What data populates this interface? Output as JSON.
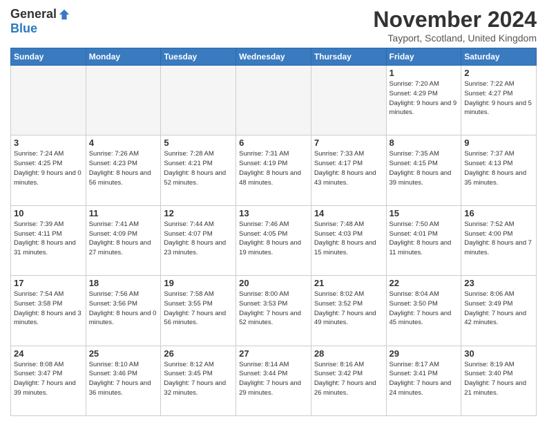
{
  "header": {
    "logo_general": "General",
    "logo_blue": "Blue",
    "month_title": "November 2024",
    "location": "Tayport, Scotland, United Kingdom"
  },
  "days_of_week": [
    "Sunday",
    "Monday",
    "Tuesday",
    "Wednesday",
    "Thursday",
    "Friday",
    "Saturday"
  ],
  "weeks": [
    [
      {
        "day": "",
        "sunrise": "",
        "sunset": "",
        "daylight": "",
        "empty": true
      },
      {
        "day": "",
        "sunrise": "",
        "sunset": "",
        "daylight": "",
        "empty": true
      },
      {
        "day": "",
        "sunrise": "",
        "sunset": "",
        "daylight": "",
        "empty": true
      },
      {
        "day": "",
        "sunrise": "",
        "sunset": "",
        "daylight": "",
        "empty": true
      },
      {
        "day": "",
        "sunrise": "",
        "sunset": "",
        "daylight": "",
        "empty": true
      },
      {
        "day": "1",
        "sunrise": "Sunrise: 7:20 AM",
        "sunset": "Sunset: 4:29 PM",
        "daylight": "Daylight: 9 hours and 9 minutes.",
        "empty": false
      },
      {
        "day": "2",
        "sunrise": "Sunrise: 7:22 AM",
        "sunset": "Sunset: 4:27 PM",
        "daylight": "Daylight: 9 hours and 5 minutes.",
        "empty": false
      }
    ],
    [
      {
        "day": "3",
        "sunrise": "Sunrise: 7:24 AM",
        "sunset": "Sunset: 4:25 PM",
        "daylight": "Daylight: 9 hours and 0 minutes.",
        "empty": false
      },
      {
        "day": "4",
        "sunrise": "Sunrise: 7:26 AM",
        "sunset": "Sunset: 4:23 PM",
        "daylight": "Daylight: 8 hours and 56 minutes.",
        "empty": false
      },
      {
        "day": "5",
        "sunrise": "Sunrise: 7:28 AM",
        "sunset": "Sunset: 4:21 PM",
        "daylight": "Daylight: 8 hours and 52 minutes.",
        "empty": false
      },
      {
        "day": "6",
        "sunrise": "Sunrise: 7:31 AM",
        "sunset": "Sunset: 4:19 PM",
        "daylight": "Daylight: 8 hours and 48 minutes.",
        "empty": false
      },
      {
        "day": "7",
        "sunrise": "Sunrise: 7:33 AM",
        "sunset": "Sunset: 4:17 PM",
        "daylight": "Daylight: 8 hours and 43 minutes.",
        "empty": false
      },
      {
        "day": "8",
        "sunrise": "Sunrise: 7:35 AM",
        "sunset": "Sunset: 4:15 PM",
        "daylight": "Daylight: 8 hours and 39 minutes.",
        "empty": false
      },
      {
        "day": "9",
        "sunrise": "Sunrise: 7:37 AM",
        "sunset": "Sunset: 4:13 PM",
        "daylight": "Daylight: 8 hours and 35 minutes.",
        "empty": false
      }
    ],
    [
      {
        "day": "10",
        "sunrise": "Sunrise: 7:39 AM",
        "sunset": "Sunset: 4:11 PM",
        "daylight": "Daylight: 8 hours and 31 minutes.",
        "empty": false
      },
      {
        "day": "11",
        "sunrise": "Sunrise: 7:41 AM",
        "sunset": "Sunset: 4:09 PM",
        "daylight": "Daylight: 8 hours and 27 minutes.",
        "empty": false
      },
      {
        "day": "12",
        "sunrise": "Sunrise: 7:44 AM",
        "sunset": "Sunset: 4:07 PM",
        "daylight": "Daylight: 8 hours and 23 minutes.",
        "empty": false
      },
      {
        "day": "13",
        "sunrise": "Sunrise: 7:46 AM",
        "sunset": "Sunset: 4:05 PM",
        "daylight": "Daylight: 8 hours and 19 minutes.",
        "empty": false
      },
      {
        "day": "14",
        "sunrise": "Sunrise: 7:48 AM",
        "sunset": "Sunset: 4:03 PM",
        "daylight": "Daylight: 8 hours and 15 minutes.",
        "empty": false
      },
      {
        "day": "15",
        "sunrise": "Sunrise: 7:50 AM",
        "sunset": "Sunset: 4:01 PM",
        "daylight": "Daylight: 8 hours and 11 minutes.",
        "empty": false
      },
      {
        "day": "16",
        "sunrise": "Sunrise: 7:52 AM",
        "sunset": "Sunset: 4:00 PM",
        "daylight": "Daylight: 8 hours and 7 minutes.",
        "empty": false
      }
    ],
    [
      {
        "day": "17",
        "sunrise": "Sunrise: 7:54 AM",
        "sunset": "Sunset: 3:58 PM",
        "daylight": "Daylight: 8 hours and 3 minutes.",
        "empty": false
      },
      {
        "day": "18",
        "sunrise": "Sunrise: 7:56 AM",
        "sunset": "Sunset: 3:56 PM",
        "daylight": "Daylight: 8 hours and 0 minutes.",
        "empty": false
      },
      {
        "day": "19",
        "sunrise": "Sunrise: 7:58 AM",
        "sunset": "Sunset: 3:55 PM",
        "daylight": "Daylight: 7 hours and 56 minutes.",
        "empty": false
      },
      {
        "day": "20",
        "sunrise": "Sunrise: 8:00 AM",
        "sunset": "Sunset: 3:53 PM",
        "daylight": "Daylight: 7 hours and 52 minutes.",
        "empty": false
      },
      {
        "day": "21",
        "sunrise": "Sunrise: 8:02 AM",
        "sunset": "Sunset: 3:52 PM",
        "daylight": "Daylight: 7 hours and 49 minutes.",
        "empty": false
      },
      {
        "day": "22",
        "sunrise": "Sunrise: 8:04 AM",
        "sunset": "Sunset: 3:50 PM",
        "daylight": "Daylight: 7 hours and 45 minutes.",
        "empty": false
      },
      {
        "day": "23",
        "sunrise": "Sunrise: 8:06 AM",
        "sunset": "Sunset: 3:49 PM",
        "daylight": "Daylight: 7 hours and 42 minutes.",
        "empty": false
      }
    ],
    [
      {
        "day": "24",
        "sunrise": "Sunrise: 8:08 AM",
        "sunset": "Sunset: 3:47 PM",
        "daylight": "Daylight: 7 hours and 39 minutes.",
        "empty": false
      },
      {
        "day": "25",
        "sunrise": "Sunrise: 8:10 AM",
        "sunset": "Sunset: 3:46 PM",
        "daylight": "Daylight: 7 hours and 36 minutes.",
        "empty": false
      },
      {
        "day": "26",
        "sunrise": "Sunrise: 8:12 AM",
        "sunset": "Sunset: 3:45 PM",
        "daylight": "Daylight: 7 hours and 32 minutes.",
        "empty": false
      },
      {
        "day": "27",
        "sunrise": "Sunrise: 8:14 AM",
        "sunset": "Sunset: 3:44 PM",
        "daylight": "Daylight: 7 hours and 29 minutes.",
        "empty": false
      },
      {
        "day": "28",
        "sunrise": "Sunrise: 8:16 AM",
        "sunset": "Sunset: 3:42 PM",
        "daylight": "Daylight: 7 hours and 26 minutes.",
        "empty": false
      },
      {
        "day": "29",
        "sunrise": "Sunrise: 8:17 AM",
        "sunset": "Sunset: 3:41 PM",
        "daylight": "Daylight: 7 hours and 24 minutes.",
        "empty": false
      },
      {
        "day": "30",
        "sunrise": "Sunrise: 8:19 AM",
        "sunset": "Sunset: 3:40 PM",
        "daylight": "Daylight: 7 hours and 21 minutes.",
        "empty": false
      }
    ]
  ]
}
